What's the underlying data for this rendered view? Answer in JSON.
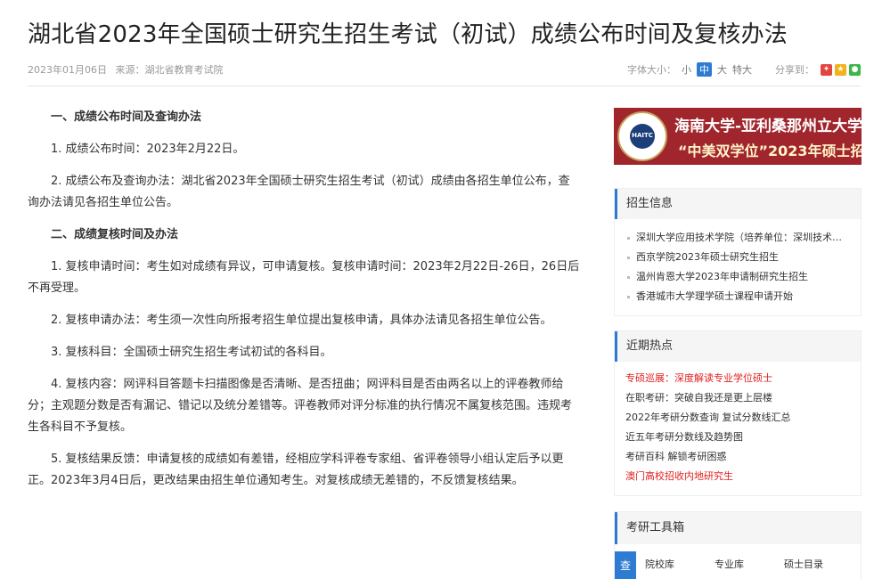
{
  "header": {
    "title": "湖北省2023年全国硕士研究生招生考试（初试）成绩公布时间及复核办法",
    "date": "2023年01月06日",
    "source": "来源：湖北省教育考试院",
    "font_size_label": "字体大小：",
    "font_sizes": [
      "小",
      "中",
      "大",
      "特大"
    ],
    "share_label": "分享到："
  },
  "article": {
    "paragraphs": [
      "一、成绩公布时间及查询办法",
      "1. 成绩公布时间：2023年2月22日。",
      "2. 成绩公布及查询办法：湖北省2023年全国硕士研究生招生考试（初试）成绩由各招生单位公布，查询办法请见各招生单位公告。",
      "二、成绩复核时间及办法",
      "1. 复核申请时间：考生如对成绩有异议，可申请复核。复核申请时间：2023年2月22日-26日，26日后不再受理。",
      "2. 复核申请办法：考生须一次性向所报考招生单位提出复核申请，具体办法请见各招生单位公告。",
      "3. 复核科目：全国硕士研究生招生考试初试的各科目。",
      "4. 复核内容：网评科目答题卡扫描图像是否清晰、是否扭曲；网评科目是否由两名以上的评卷教师给分；主观题分数是否有漏记、错记以及统分差错等。评卷教师对评分标准的执行情况不属复核范围。违规考生各科目不予复核。",
      "5. 复核结果反馈：申请复核的成绩如有差错，经相应学科评卷专家组、省评卷领导小组认定后予以更正。2023年3月4日后，更改结果由招生单位通知考生。对复核成绩无差错的，不反馈复核结果。"
    ]
  },
  "ad": {
    "logo_text": "HAITC",
    "line1": "海南大学-亚利桑那州立大学",
    "line2": "“中美双学位”2023年硕士招生"
  },
  "sidebar": {
    "admissions": {
      "title": "招生信息",
      "items": [
        "深圳大学应用技术学院（培养单位：深圳技术大学）",
        "西京学院2023年硕士研究生招生",
        "温州肯恩大学2023年申请制研究生招生",
        "香港城市大学理学硕士课程申请开始"
      ]
    },
    "hot": {
      "title": "近期热点",
      "items": [
        "专硕巡展：深度解读专业学位硕士",
        "在职考研：突破自我还是更上层楼",
        "2022年考研分数查询 复试分数线汇总",
        "近五年考研分数线及趋势图",
        "考研百科 解锁考研困惑",
        "澳门高校招收内地研究生"
      ]
    },
    "toolbox": {
      "title": "考研工具箱",
      "query": "查",
      "tools": [
        "院校库",
        "专业库",
        "硕士目录"
      ]
    }
  },
  "colors": {
    "accent": "#2e7bd2",
    "hot_red": "#e02020",
    "ad_bg": "#a0252c"
  }
}
